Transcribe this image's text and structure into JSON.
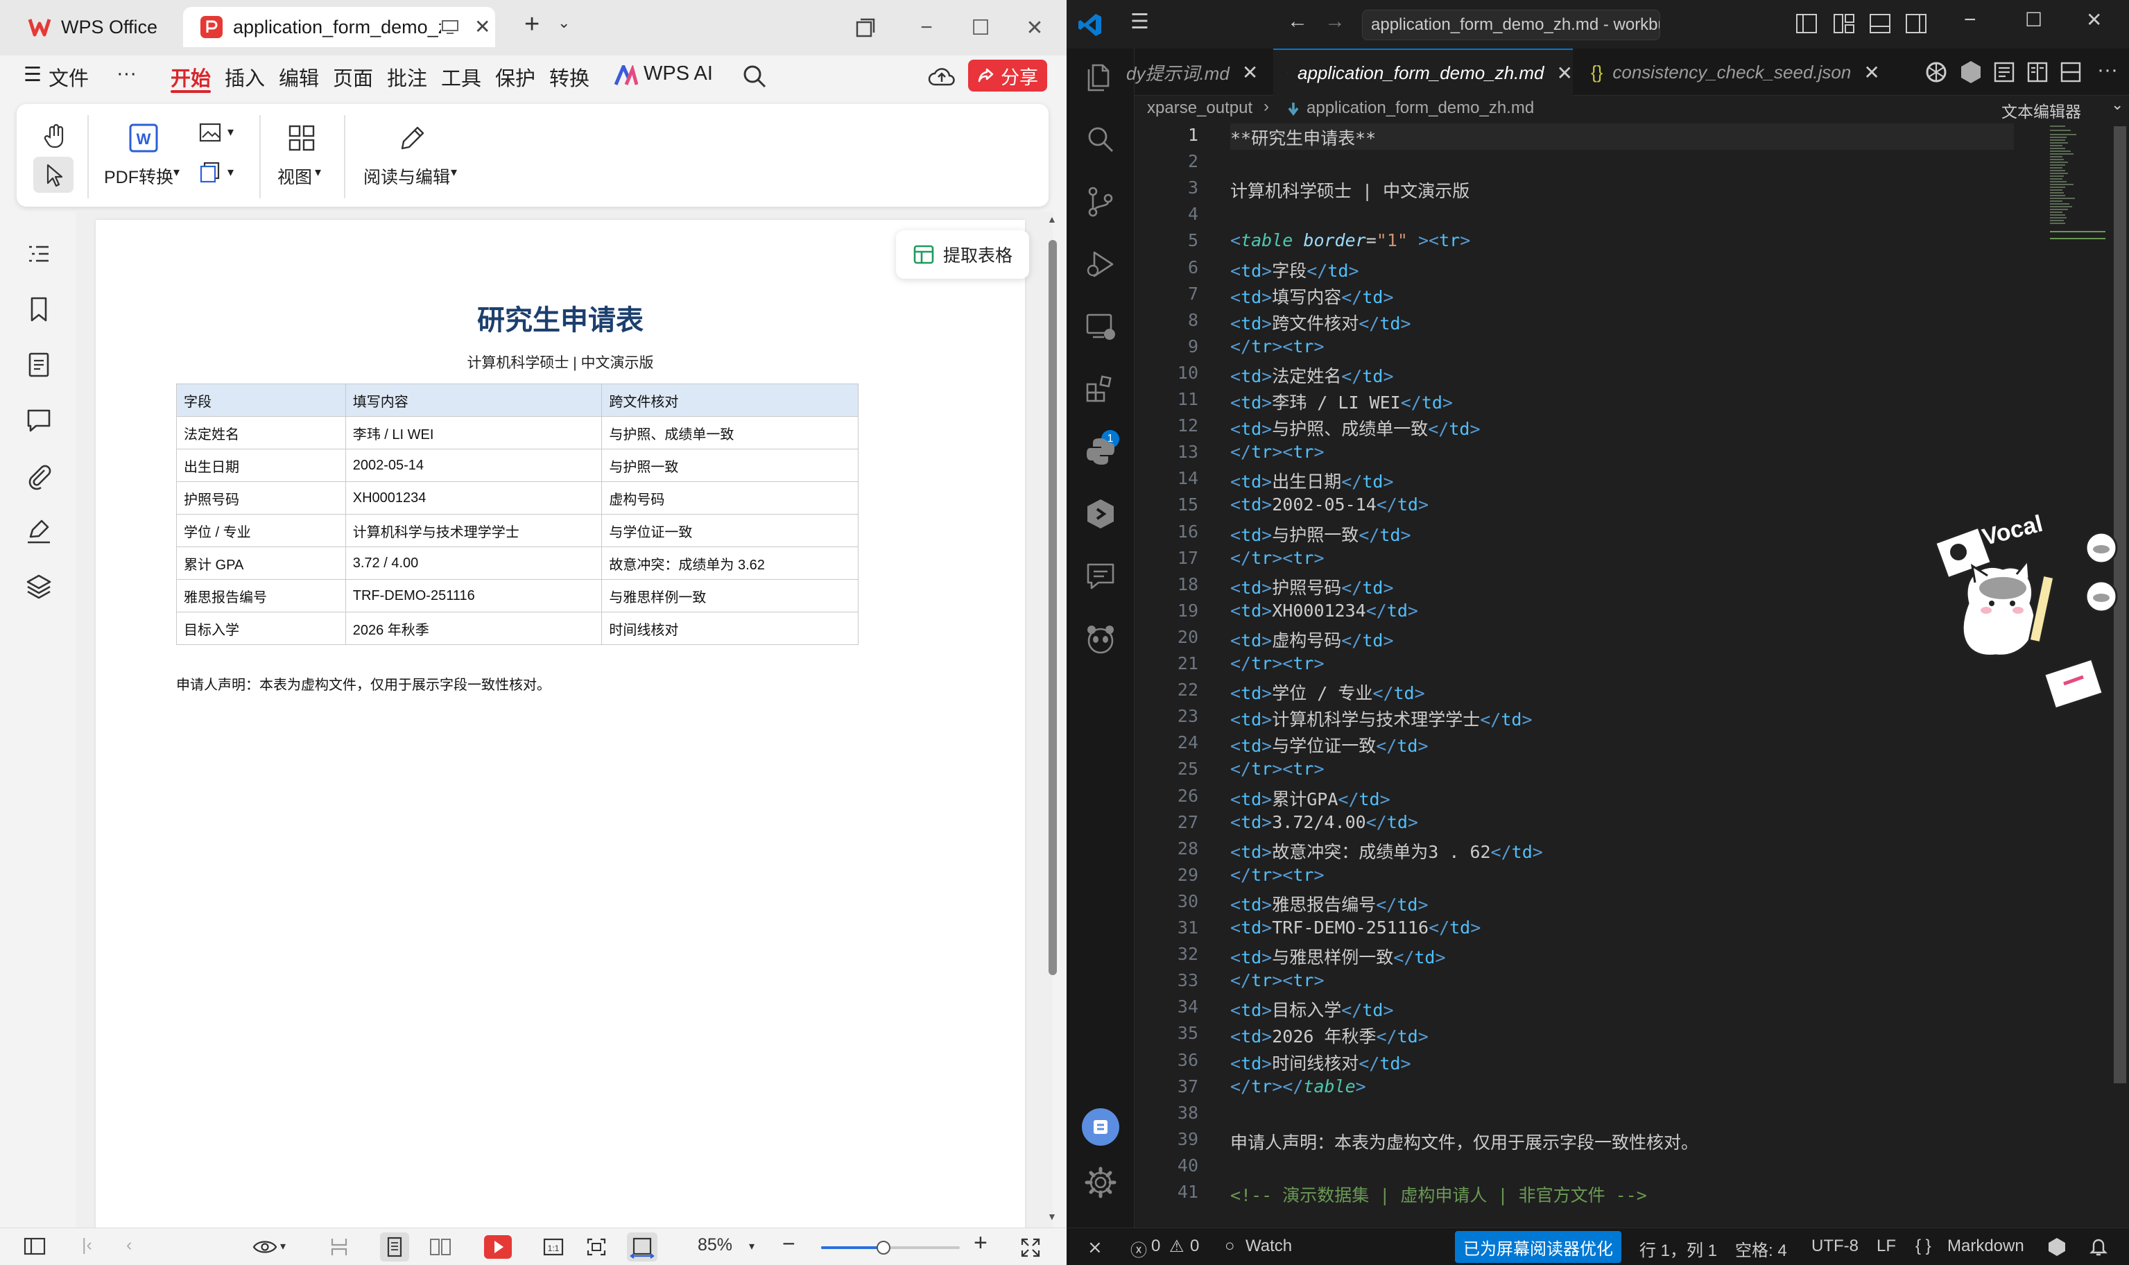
{
  "wps": {
    "app_tab": "WPS Office",
    "doc_tab": "application_form_demo_zh.pdf",
    "menu": [
      "文件",
      "···",
      "开始",
      "插入",
      "编辑",
      "页面",
      "批注",
      "工具",
      "保护",
      "转换",
      "WPS AI"
    ],
    "share": "分享",
    "ribbon": {
      "pdf_convert": "PDF转换",
      "view": "视图",
      "read_edit": "阅读与编辑"
    },
    "extract_table": "提取表格",
    "document": {
      "title": "研究生申请表",
      "subtitle": "计算机科学硕士 | 中文演示版",
      "table": {
        "headers": [
          "字段",
          "填写内容",
          "跨文件核对"
        ],
        "rows": [
          [
            "法定姓名",
            "李玮 / LI WEI",
            "与护照、成绩单一致"
          ],
          [
            "出生日期",
            "2002-05-14",
            "与护照一致"
          ],
          [
            "护照号码",
            "XH0001234",
            "虚构号码"
          ],
          [
            "学位 / 专业",
            "计算机科学与技术理学学士",
            "与学位证一致"
          ],
          [
            "累计 GPA",
            "3.72 / 4.00",
            "故意冲突：成绩单为 3.62"
          ],
          [
            "雅思报告编号",
            "TRF-DEMO-251116",
            "与雅思样例一致"
          ],
          [
            "目标入学",
            "2026 年秋季",
            "时间线核对"
          ]
        ]
      },
      "declaration": "申请人声明：本表为虚构文件，仅用于展示字段一致性核对。"
    },
    "status": {
      "zoom": "85%"
    }
  },
  "vscode": {
    "title": "application_form_demo_zh.md - workbuddy - Visual Studio Code",
    "tabs": [
      {
        "label": "dy提示词.md",
        "active": false
      },
      {
        "label": "application_form_demo_zh.md",
        "active": true
      },
      {
        "label": "consistency_check_seed.json",
        "active": false
      }
    ],
    "breadcrumb": {
      "folder": "xparse_output",
      "file": "application_form_demo_zh.md",
      "mode": "文本编辑器"
    },
    "lines": [
      "**研究生申请表**",
      "",
      "计算机科学硕士 | 中文演示版",
      "",
      "<table border=\"1\" ><tr>",
      "<td>字段</td>",
      "<td>填写内容</td>",
      "<td>跨文件核对</td>",
      "</tr><tr>",
      "<td>法定姓名</td>",
      "<td>李玮 / LI WEI</td>",
      "<td>与护照、成绩单一致</td>",
      "</tr><tr>",
      "<td>出生日期</td>",
      "<td>2002-05-14</td>",
      "<td>与护照一致</td>",
      "</tr><tr>",
      "<td>护照号码</td>",
      "<td>XH0001234</td>",
      "<td>虚构号码</td>",
      "</tr><tr>",
      "<td>学位 / 专业</td>",
      "<td>计算机科学与技术理学学士</td>",
      "<td>与学位证一致</td>",
      "</tr><tr>",
      "<td>累计GPA</td>",
      "<td>3.72/4.00</td>",
      "<td>故意冲突：成绩单为3 . 62</td>",
      "</tr><tr>",
      "<td>雅思报告编号</td>",
      "<td>TRF-DEMO-251116</td>",
      "<td>与雅思样例一致</td>",
      "</tr><tr>",
      "<td>目标入学</td>",
      "<td>2026 年秋季</td>",
      "<td>时间线核对</td>",
      "</tr></table>",
      "",
      "申请人声明：本表为虚构文件，仅用于展示字段一致性核对。",
      "",
      "<!-- 演示数据集 | 虚构申请人 | 非官方文件 -->"
    ],
    "status": {
      "problems": "0",
      "warnings": "0",
      "watch": "Watch",
      "screen_reader": "已为屏幕阅读器优化",
      "position": "行 1，列 1",
      "spaces": "空格: 4",
      "encoding": "UTF-8",
      "eol": "LF",
      "language": "Markdown",
      "extensions_badge": "1"
    },
    "sticker_text": "Vocal"
  }
}
